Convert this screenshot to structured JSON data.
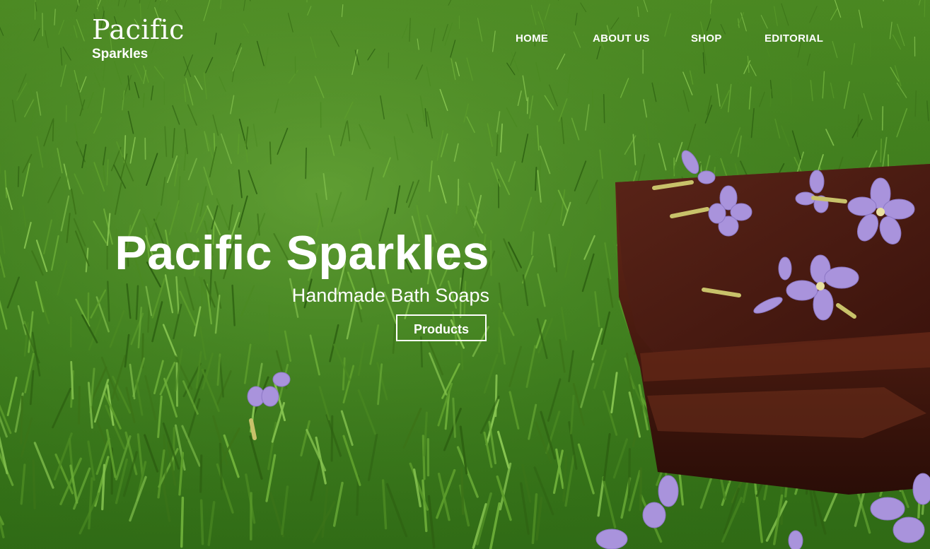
{
  "brand": {
    "name": "Pacific",
    "tagline": "Sparkles"
  },
  "nav": {
    "items": [
      {
        "label": "HOME"
      },
      {
        "label": "ABOUT US"
      },
      {
        "label": "SHOP"
      },
      {
        "label": "EDITORIAL"
      }
    ]
  },
  "hero": {
    "title": "Pacific Sparkles",
    "subtitle": "Handmade Bath Soaps",
    "cta_label": "Products",
    "image_subject": "soap-bar-on-grass-with-purple-flowers"
  },
  "colors": {
    "text": "#ffffff",
    "grass_light": "#6aa838",
    "grass_dark": "#2f6a15",
    "soap": "#4a1d14",
    "flower": "#a993dc"
  }
}
